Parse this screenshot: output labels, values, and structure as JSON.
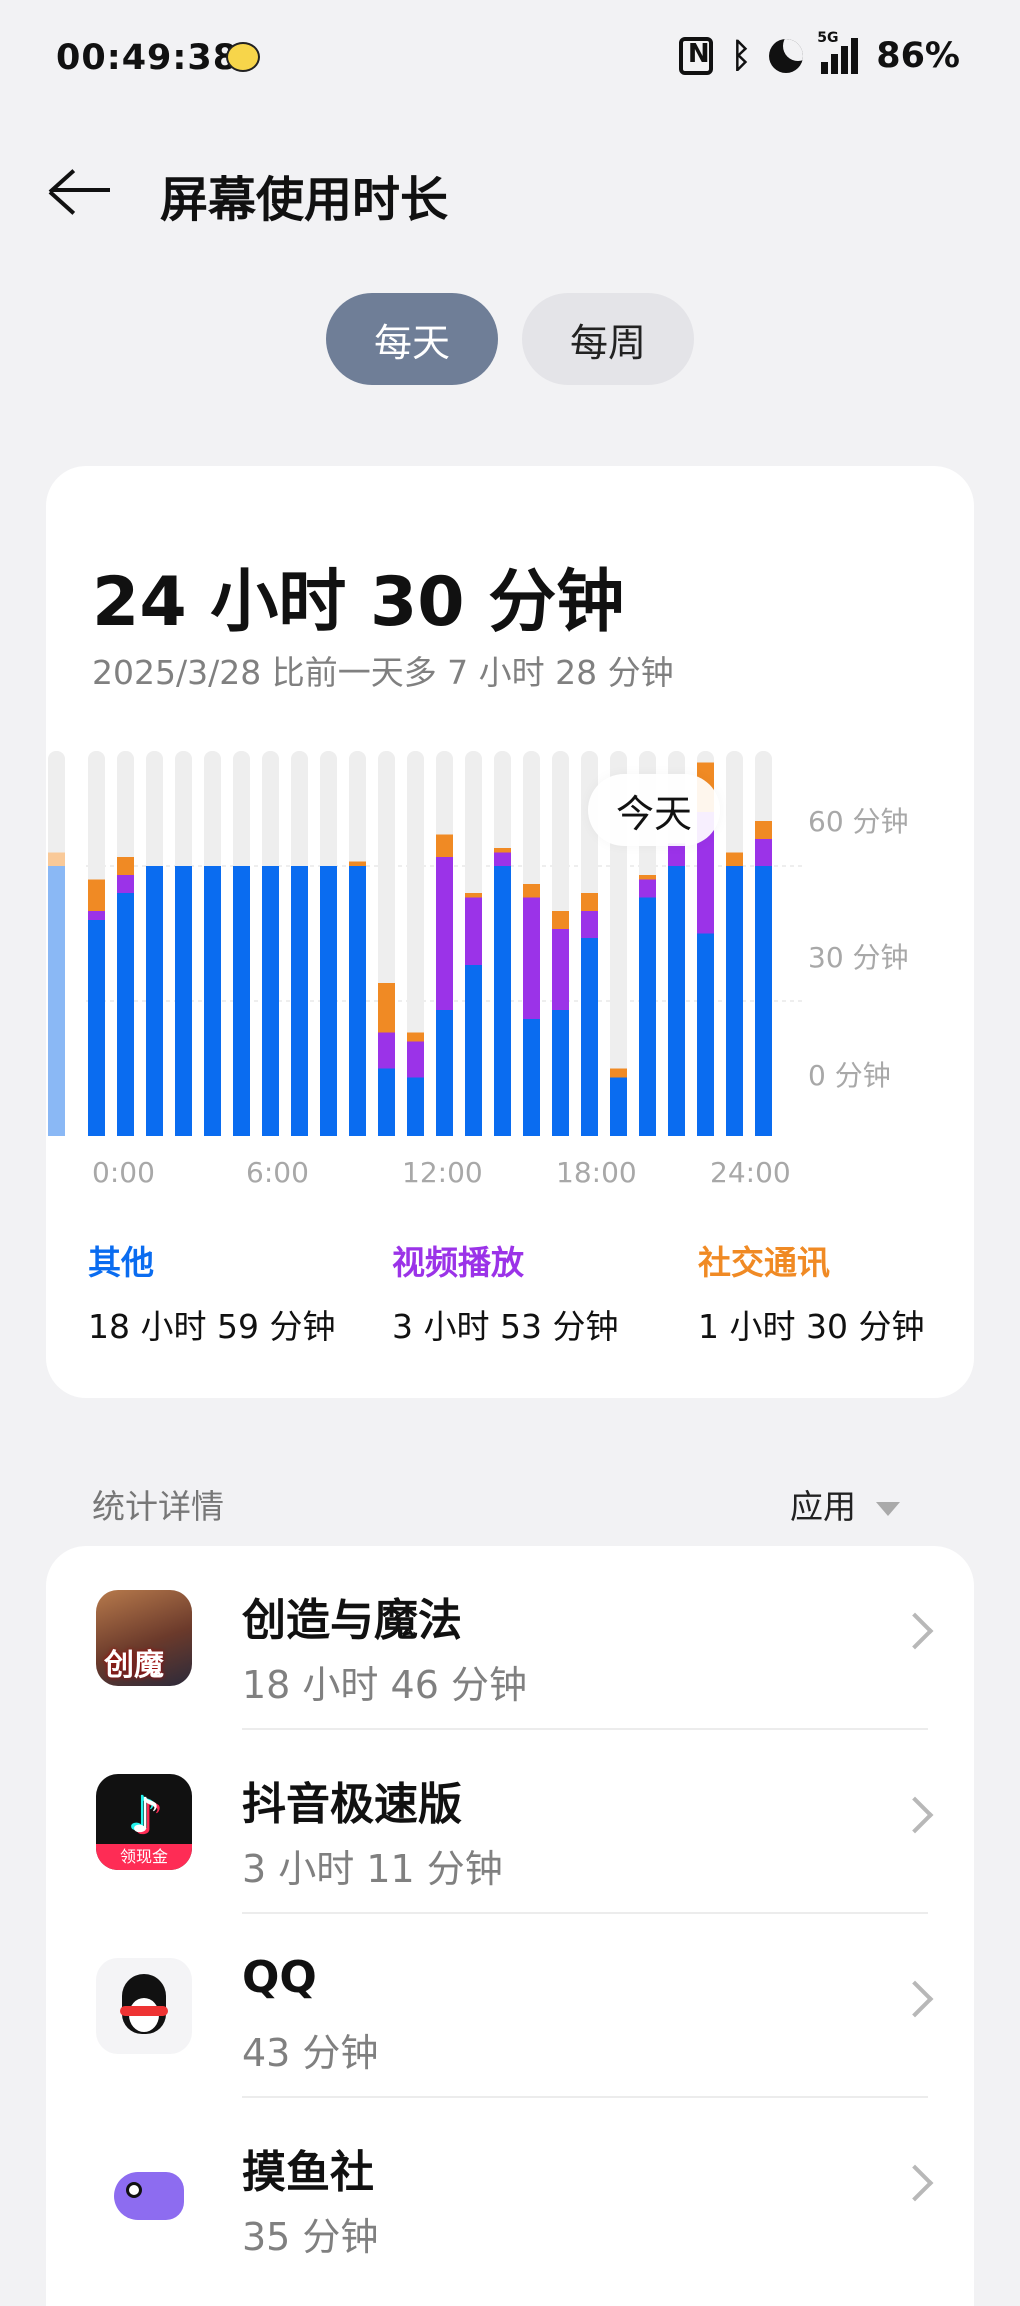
{
  "status_bar": {
    "time": "00:49:38",
    "signal_label": "5G",
    "battery": "86%"
  },
  "header": {
    "title": "屏幕使用时长"
  },
  "segments": {
    "day": "每天",
    "week": "每周",
    "active": "day"
  },
  "summary": {
    "total": "24 小时 30 分钟",
    "compare": "2025/3/28 比前一天多 7 小时 28 分钟",
    "today_label": "今天"
  },
  "colors": {
    "other": "#0a6cf0",
    "video": "#9b33e8",
    "social": "#f08a24",
    "empty": "#eeeeee",
    "partial_other": "#8ab8f5",
    "partial_social": "#f9c998"
  },
  "chart_data": {
    "type": "bar",
    "stacked": true,
    "unit": "分钟",
    "yticks": [
      "60 分钟",
      "30 分钟",
      "0 分钟"
    ],
    "ylim": [
      0,
      60
    ],
    "xticks": [
      "0:00",
      "6:00",
      "12:00",
      "18:00",
      "24:00"
    ],
    "categories": [
      "0",
      "1",
      "2",
      "3",
      "4",
      "5",
      "6",
      "7",
      "8",
      "9",
      "10",
      "11",
      "12",
      "13",
      "14",
      "15",
      "16",
      "17",
      "18",
      "19",
      "20",
      "21",
      "22",
      "23"
    ],
    "series": [
      {
        "name": "其他",
        "values": [
          48,
          54,
          60,
          60,
          60,
          60,
          60,
          60,
          60,
          60,
          15,
          13,
          28,
          38,
          60,
          26,
          28,
          44,
          13,
          53,
          60,
          45,
          60,
          60
        ]
      },
      {
        "name": "视频播放",
        "values": [
          2,
          4,
          0,
          0,
          0,
          0,
          0,
          0,
          0,
          0,
          8,
          8,
          34,
          15,
          3,
          27,
          18,
          6,
          0,
          4,
          5,
          27,
          0,
          6
        ]
      },
      {
        "name": "社交通讯",
        "values": [
          7,
          4,
          0,
          0,
          0,
          0,
          0,
          0,
          0,
          1,
          11,
          2,
          5,
          1,
          1,
          3,
          4,
          4,
          2,
          1,
          0,
          11,
          3,
          4
        ]
      }
    ],
    "partial_day_before": {
      "other": 60,
      "social": 3
    }
  },
  "legend": [
    {
      "name": "其他",
      "value": "18 小时 59 分钟"
    },
    {
      "name": "视频播放",
      "value": "3 小时 53 分钟"
    },
    {
      "name": "社交通讯",
      "value": "1 小时 30 分钟"
    }
  ],
  "details": {
    "title": "统计详情",
    "sort": "应用"
  },
  "apps": [
    {
      "name": "创造与魔法",
      "time": "18 小时 46 分钟",
      "icon": "game-icon"
    },
    {
      "name": "抖音极速版",
      "time": "3 小时 11 分钟",
      "icon": "douyin-icon",
      "badge": "领现金"
    },
    {
      "name": "QQ",
      "time": "43 分钟",
      "icon": "qq-icon"
    },
    {
      "name": "摸鱼社",
      "time": "35 分钟",
      "icon": "fish-icon"
    }
  ]
}
